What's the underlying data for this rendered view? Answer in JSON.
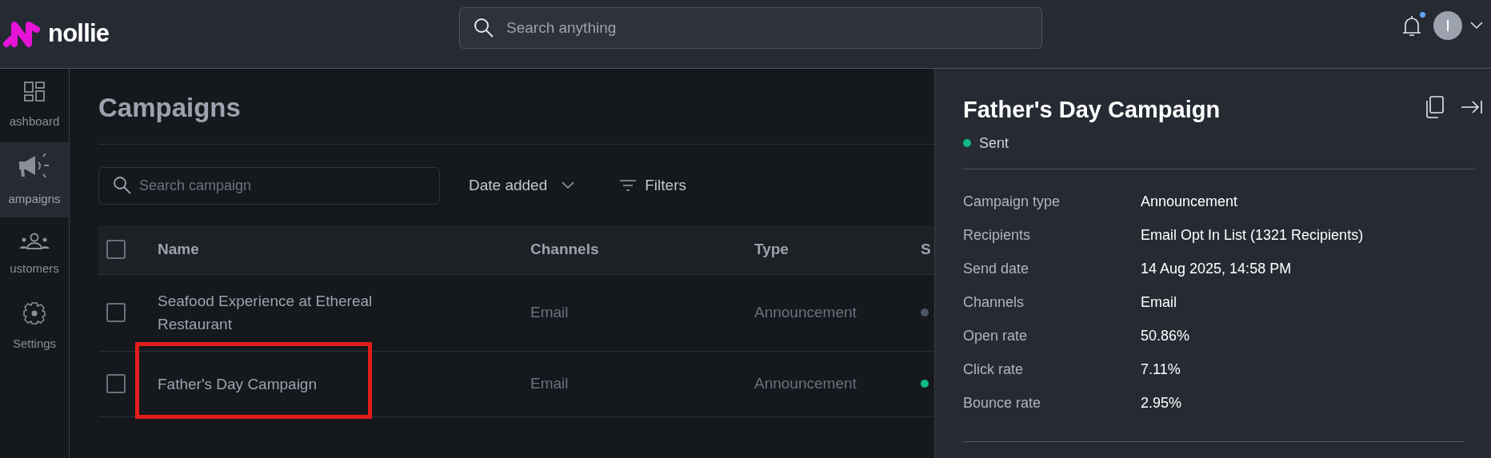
{
  "brand": {
    "name": "nollie"
  },
  "search": {
    "placeholder": "Search anything"
  },
  "notifications": {
    "unread": true
  },
  "avatar": {
    "initial": "I"
  },
  "sidebar": {
    "items": [
      {
        "label": "ashboard",
        "selected": false
      },
      {
        "label": "ampaigns",
        "selected": true
      },
      {
        "label": "ustomers",
        "selected": false
      },
      {
        "label": "Settings",
        "selected": false
      }
    ]
  },
  "page": {
    "title": "Campaigns"
  },
  "toolbar": {
    "search_placeholder": "Search campaign",
    "sort": "Date added",
    "filters": "Filters"
  },
  "table": {
    "select_all_checked": false,
    "columns": [
      "Name",
      "Channels",
      "Type",
      "S"
    ],
    "rows": [
      {
        "name": "Seafood Experience at Ethereal Restaurant",
        "channels": "Email",
        "type": "Announcement",
        "color": "#4b5563",
        "highlighted": false,
        "checked": false
      },
      {
        "name": "Father's Day Campaign",
        "channels": "Email",
        "type": "Announcement",
        "color": "#10b981",
        "highlighted": true,
        "checked": false
      }
    ]
  },
  "details": {
    "title": "Father's Day Campaign",
    "status": {
      "label": "Sent",
      "color": "#10b981"
    },
    "fields": [
      {
        "label": "Campaign type",
        "value": "Announcement"
      },
      {
        "label": "Recipients",
        "value": "Email Opt In List (1321 Recipients)"
      },
      {
        "label": "Send date",
        "value": "14 Aug 2025, 14:58 PM"
      },
      {
        "label": "Channels",
        "value": "Email"
      },
      {
        "label": "Open rate",
        "value": "50.86%"
      },
      {
        "label": "Click rate",
        "value": "7.11%"
      },
      {
        "label": "Bounce rate",
        "value": "2.95%"
      }
    ]
  }
}
